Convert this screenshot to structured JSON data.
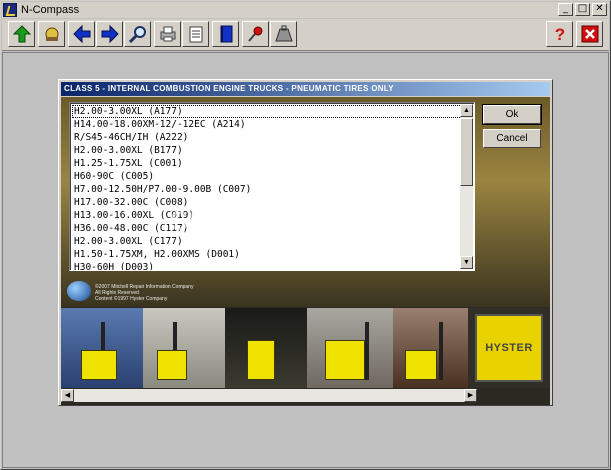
{
  "window": {
    "title": "N-Compass"
  },
  "title_buttons": {
    "minimize": "_",
    "maximize": "□",
    "close": "✕"
  },
  "toolbar": {
    "colors": {
      "green": "#1a9a1a",
      "blue": "#1030c8",
      "red": "#d01010"
    }
  },
  "dialog": {
    "title": "CLASS 5 - INTERNAL COMBUSTION ENGINE TRUCKS - PNEUMATIC TIRES ONLY",
    "ok_label": "Ok",
    "cancel_label": "Cancel",
    "items": [
      "H2.00-3.00XL (A177)",
      "H14.00-18.00XM-12/-12EC (A214)",
      "R/S45-46CH/IH (A222)",
      "H2.00-3.00XL (B177)",
      "H1.25-1.75XL (C001)",
      "H60-90C (C005)",
      "H7.00-12.50H/P7.00-9.00B (C007)",
      "H17.00-32.00C (C008)",
      "H13.00-16.00XL (C019)",
      "H36.00-48.00C (C117)",
      "H2.00-3.00XL (C177)",
      "H1.50-1.75XM, H2.00XMS (D001)",
      "H30-60H (D003)"
    ],
    "copyright": [
      "©2007 Mitchell Repair Information Company",
      "All Rights Reserved",
      "Content ©1997 Hyster Company"
    ],
    "brand_logo": "HYSTER"
  },
  "watermark": "Store No: 1907068"
}
